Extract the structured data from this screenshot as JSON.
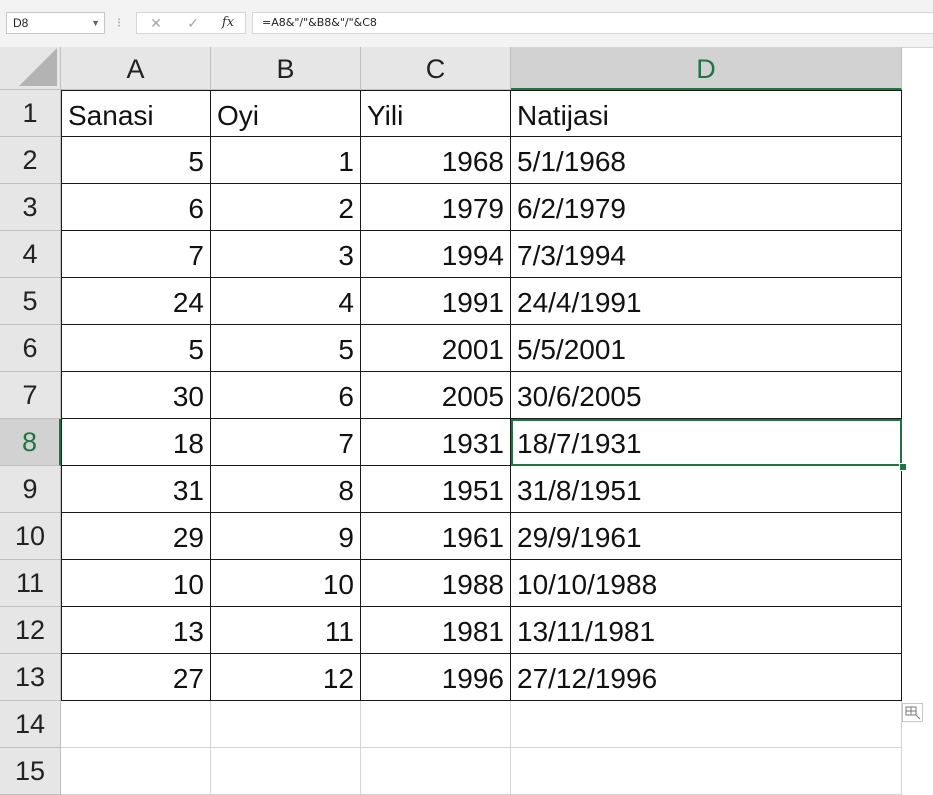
{
  "formula_bar": {
    "name_box": "D8",
    "separator": "⁝",
    "cancel": "✕",
    "enter": "✓",
    "fx": "fx",
    "formula": "=A8&\"/\"&B8&\"/\"&C8"
  },
  "columns": [
    "A",
    "B",
    "C",
    "D"
  ],
  "selected_column": "D",
  "selected_row": 8,
  "rows": [
    {
      "n": "1",
      "a": "Sanasi",
      "b": "Oyi",
      "c": "Yili",
      "d": "Natijasi"
    },
    {
      "n": "2",
      "a": "5",
      "b": "1",
      "c": "1968",
      "d": "5/1/1968"
    },
    {
      "n": "3",
      "a": "6",
      "b": "2",
      "c": "1979",
      "d": "6/2/1979"
    },
    {
      "n": "4",
      "a": "7",
      "b": "3",
      "c": "1994",
      "d": "7/3/1994"
    },
    {
      "n": "5",
      "a": "24",
      "b": "4",
      "c": "1991",
      "d": "24/4/1991"
    },
    {
      "n": "6",
      "a": "5",
      "b": "5",
      "c": "2001",
      "d": "5/5/2001"
    },
    {
      "n": "7",
      "a": "30",
      "b": "6",
      "c": "2005",
      "d": "30/6/2005"
    },
    {
      "n": "8",
      "a": "18",
      "b": "7",
      "c": "1931",
      "d": "18/7/1931"
    },
    {
      "n": "9",
      "a": "31",
      "b": "8",
      "c": "1951",
      "d": "31/8/1951"
    },
    {
      "n": "10",
      "a": "29",
      "b": "9",
      "c": "1961",
      "d": "29/9/1961"
    },
    {
      "n": "11",
      "a": "10",
      "b": "10",
      "c": "1988",
      "d": "10/10/1988"
    },
    {
      "n": "12",
      "a": "13",
      "b": "11",
      "c": "1981",
      "d": "13/11/1981"
    },
    {
      "n": "13",
      "a": "27",
      "b": "12",
      "c": "1996",
      "d": "27/12/1996"
    },
    {
      "n": "14",
      "a": "",
      "b": "",
      "c": "",
      "d": ""
    },
    {
      "n": "15",
      "a": "",
      "b": "",
      "c": "",
      "d": ""
    }
  ],
  "colors": {
    "accent": "#217346"
  },
  "icons": {
    "quick_analysis": "quick-analysis-icon",
    "select_all": "select-all-triangle"
  }
}
